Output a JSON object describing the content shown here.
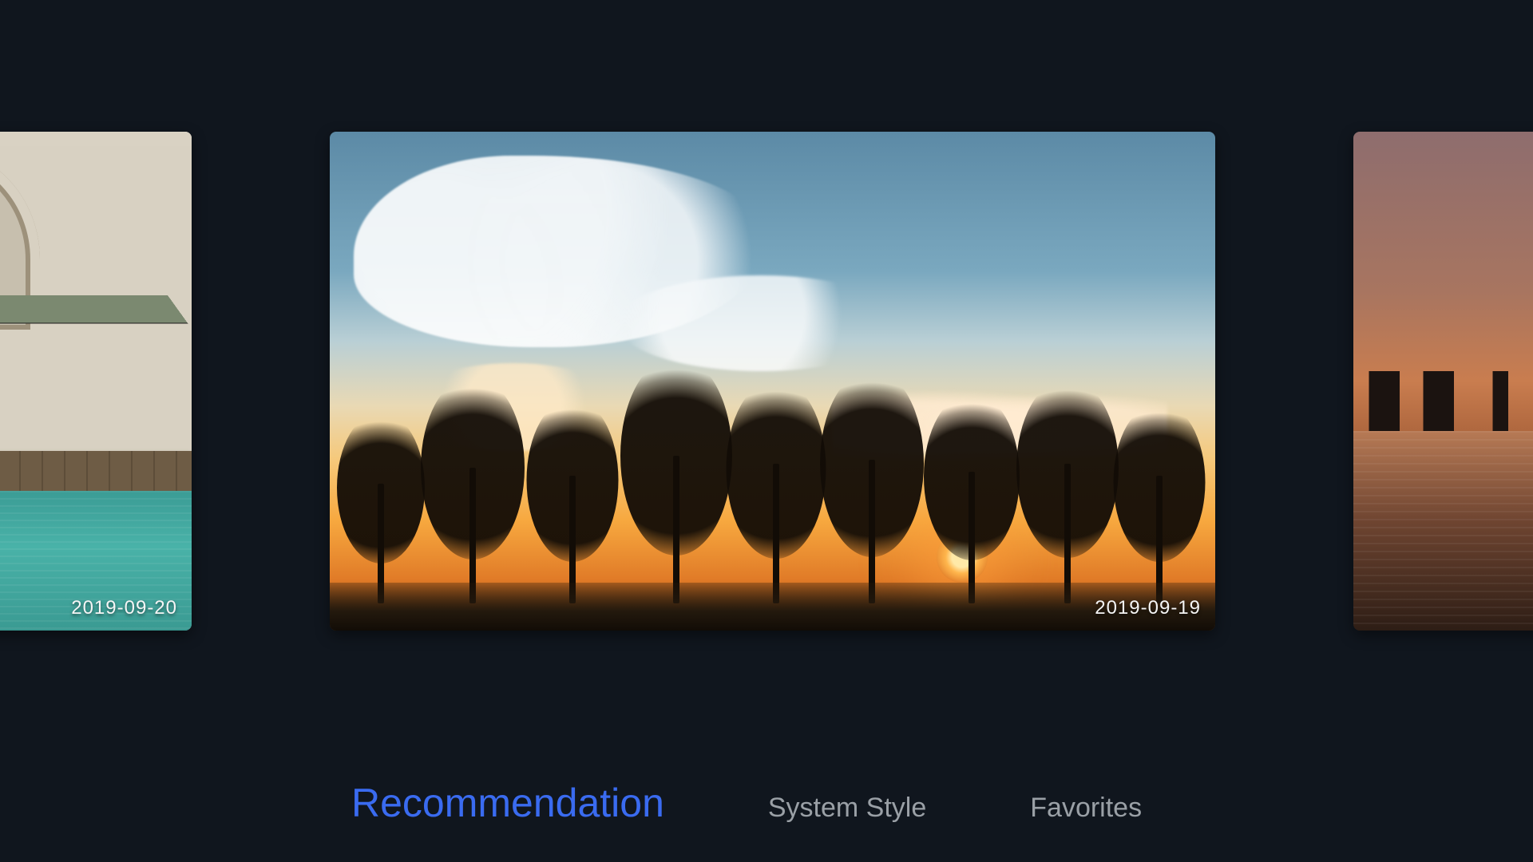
{
  "carousel": {
    "left": {
      "date": "2019-09-20"
    },
    "center": {
      "date": "2019-09-19"
    },
    "right": {
      "date": ""
    }
  },
  "tabs": {
    "recommendation": "Recommendation",
    "system_style": "System Style",
    "favorites": "Favorites"
  }
}
